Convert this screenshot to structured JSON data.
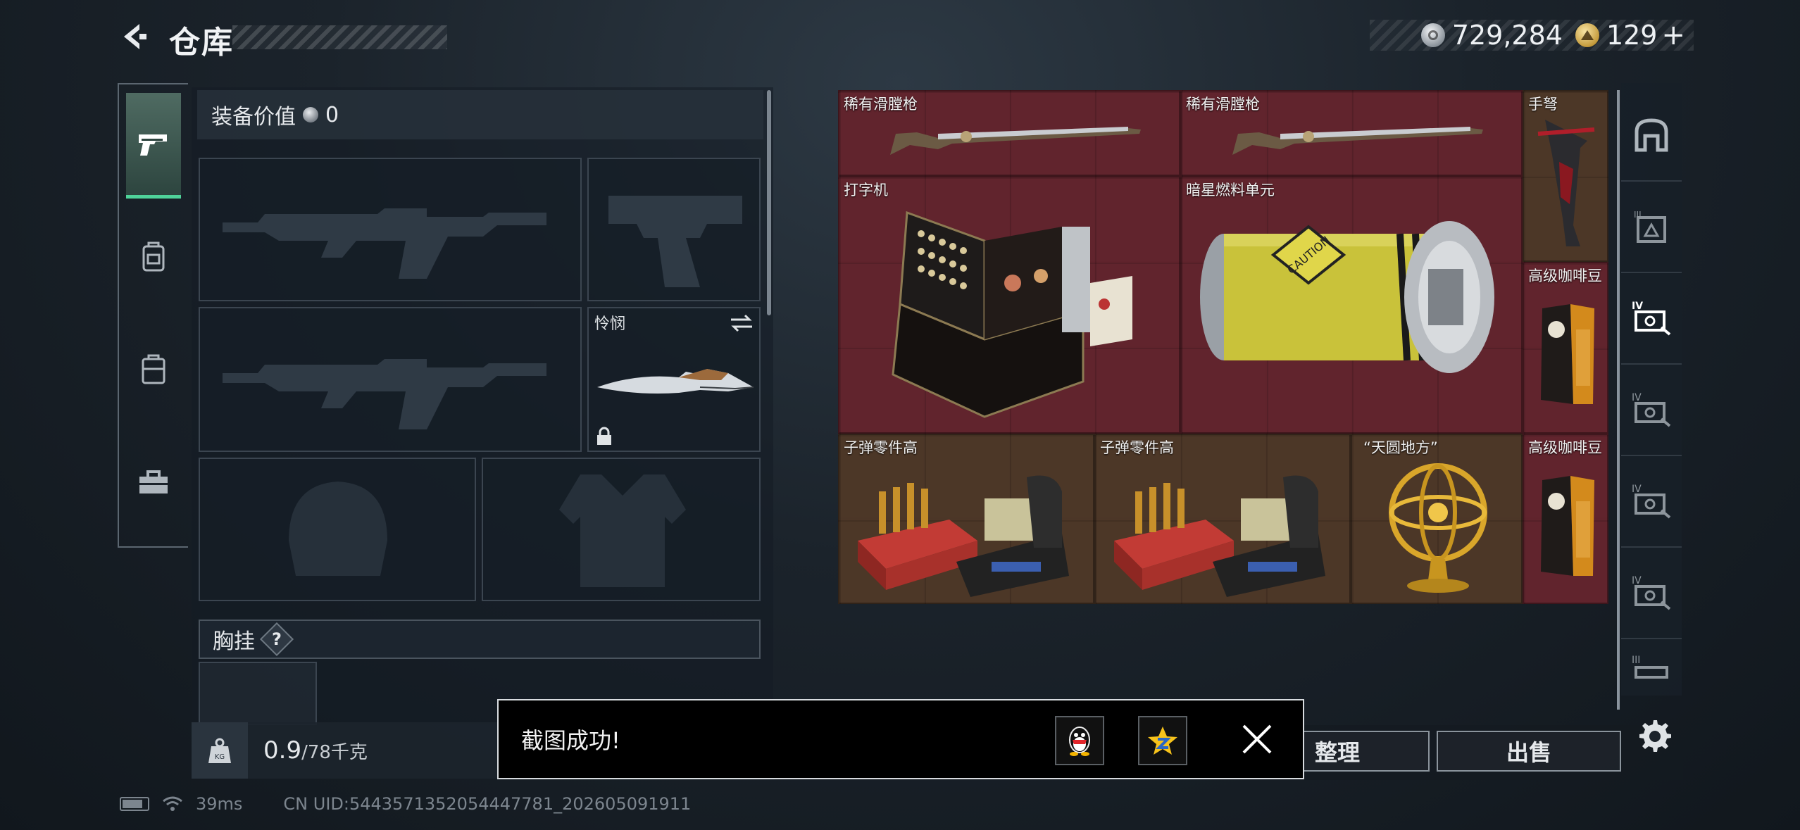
{
  "header": {
    "title": "仓库",
    "currency_silver": "729,284",
    "currency_gold": "129",
    "currency_gold_plus": "+"
  },
  "categories": [
    {
      "name": "weapons",
      "icon": "pistol-icon",
      "active": true
    },
    {
      "name": "equipment",
      "icon": "backpack-icon",
      "active": false
    },
    {
      "name": "backpack",
      "icon": "bag-icon",
      "active": false
    },
    {
      "name": "toolbox",
      "icon": "toolbox-icon",
      "active": false
    }
  ],
  "equipment": {
    "value_label": "装备价值",
    "value": "0",
    "melee_label": "怜悯",
    "chest_label": "胸挂",
    "chest_help": "?",
    "weight_current": "0.9",
    "weight_max": "/78千克",
    "weight_icon_text": "KG"
  },
  "storage": {
    "items": [
      {
        "label": "稀有滑膛枪",
        "color": "red"
      },
      {
        "label": "稀有滑膛枪",
        "color": "red"
      },
      {
        "label": "手弩",
        "color": "brown"
      },
      {
        "label": "打字机",
        "color": "red"
      },
      {
        "label": "暗星燃料单元",
        "color": "red"
      },
      {
        "label": "高级咖啡豆",
        "color": "red"
      },
      {
        "label": "子弹零件高",
        "color": "brown"
      },
      {
        "label": "子弹零件高",
        "color": "brown"
      },
      {
        "label": "“天圆地方”",
        "color": "brown"
      },
      {
        "label": "高级咖啡豆",
        "color": "red"
      }
    ],
    "side_tabs": [
      {
        "icon": "home-icon",
        "tier": ""
      },
      {
        "icon": "case-tier-icon",
        "tier": "III"
      },
      {
        "icon": "case-tier-icon",
        "tier": "IV"
      },
      {
        "icon": "case-tier-icon",
        "tier": "IV"
      },
      {
        "icon": "case-tier-icon",
        "tier": "IV"
      },
      {
        "icon": "case-tier-icon",
        "tier": "IV"
      },
      {
        "icon": "case-tier-icon",
        "tier": "III"
      }
    ],
    "organize_label": "整理",
    "sell_label": "出售"
  },
  "toast": {
    "message": "截图成功!"
  },
  "status_bar": {
    "ping": "39ms",
    "uid": "CN UID:5443571352054447781_202605091911"
  },
  "colors": {
    "accent_green": "#4fd39a",
    "rarity_red": "#6e2630",
    "rarity_brown": "#503a28"
  }
}
